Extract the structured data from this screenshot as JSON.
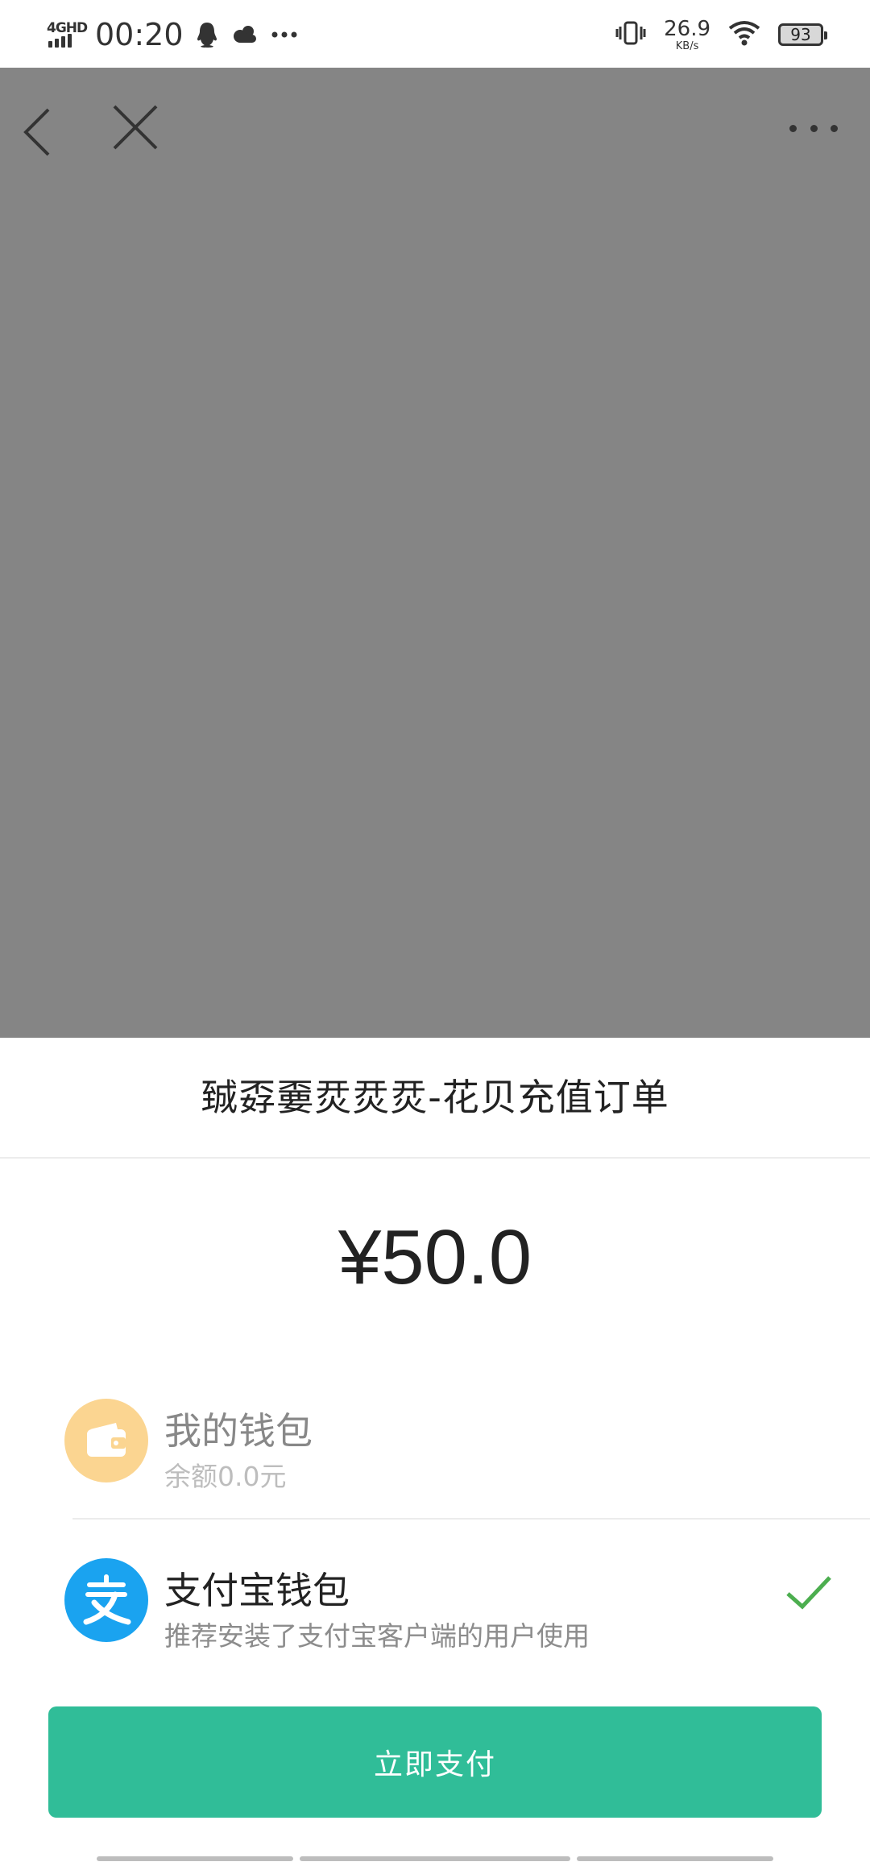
{
  "status_bar": {
    "network": "4GHD",
    "time": "00:20",
    "speed_value": "26.9",
    "speed_unit": "KB/s",
    "battery": "93",
    "icons": [
      "qq-icon",
      "cloud-icon",
      "more-dots-icon",
      "vibrate-icon",
      "wifi-icon",
      "battery-icon"
    ]
  },
  "webview_nav": {
    "icons": [
      "back-icon",
      "close-icon",
      "more-icon"
    ]
  },
  "payment": {
    "order_title": "臹孬嫑烎烎烎-花贝充值订单",
    "amount": "¥50.0",
    "methods": [
      {
        "icon": "wallet-icon",
        "title": "我的钱包",
        "subtitle": "余额0.0元",
        "selected": false,
        "enabled": false,
        "icon_color": "#fbd591"
      },
      {
        "icon": "alipay-icon",
        "title": "支付宝钱包",
        "subtitle": "推荐安装了支付宝客户端的用户使用",
        "selected": true,
        "enabled": true,
        "icon_color": "#1aa3f0"
      }
    ],
    "pay_button": "立即支付"
  },
  "colors": {
    "accent": "#30bd98",
    "overlay": "#858585",
    "check": "#4cae4f"
  }
}
